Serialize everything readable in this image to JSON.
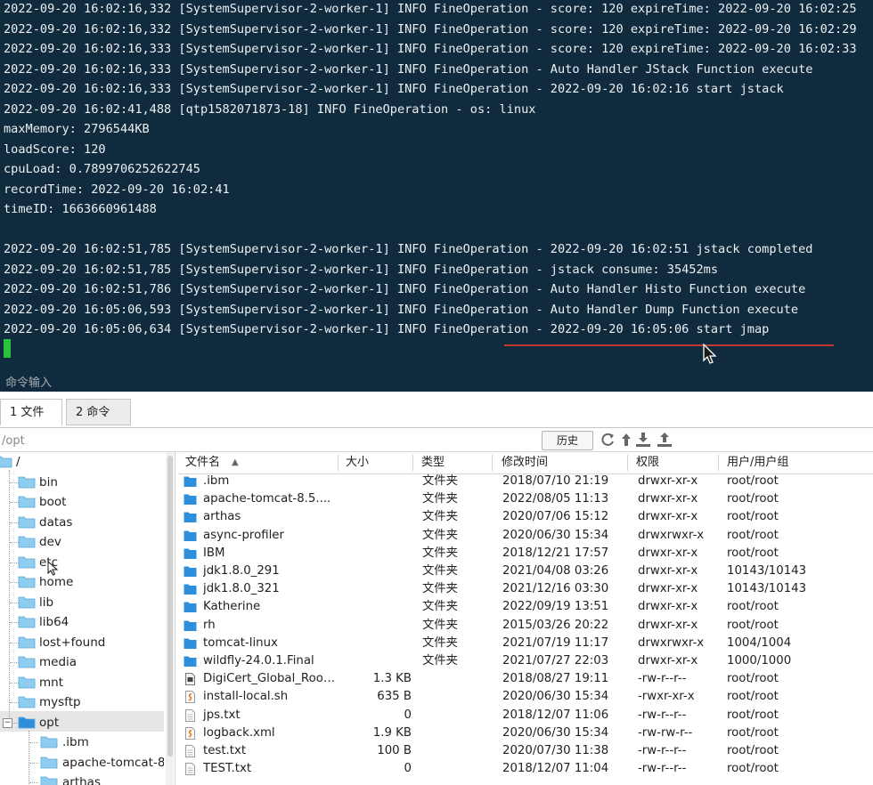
{
  "terminal": {
    "lines": [
      "2022-09-20 16:02:16,332 [SystemSupervisor-2-worker-1] INFO FineOperation - score: 120 expireTime: 2022-09-20 16:02:25",
      "2022-09-20 16:02:16,332 [SystemSupervisor-2-worker-1] INFO FineOperation - score: 120 expireTime: 2022-09-20 16:02:29",
      "2022-09-20 16:02:16,333 [SystemSupervisor-2-worker-1] INFO FineOperation - score: 120 expireTime: 2022-09-20 16:02:33",
      "2022-09-20 16:02:16,333 [SystemSupervisor-2-worker-1] INFO FineOperation - Auto Handler JStack Function execute",
      "2022-09-20 16:02:16,333 [SystemSupervisor-2-worker-1] INFO FineOperation - 2022-09-20 16:02:16 start jstack",
      "2022-09-20 16:02:41,488 [qtp1582071873-18] INFO FineOperation - os: linux",
      "maxMemory: 2796544KB",
      "loadScore: 120",
      "cpuLoad: 0.7899706252622745",
      "recordTime: 2022-09-20 16:02:41",
      "timeID: 1663660961488",
      "",
      "2022-09-20 16:02:51,785 [SystemSupervisor-2-worker-1] INFO FineOperation - 2022-09-20 16:02:51 jstack completed",
      "2022-09-20 16:02:51,785 [SystemSupervisor-2-worker-1] INFO FineOperation - jstack consume: 35452ms",
      "2022-09-20 16:02:51,786 [SystemSupervisor-2-worker-1] INFO FineOperation - Auto Handler Histo Function execute",
      "2022-09-20 16:05:06,593 [SystemSupervisor-2-worker-1] INFO FineOperation - Auto Handler Dump Function execute",
      "2022-09-20 16:05:06,634 [SystemSupervisor-2-worker-1] INFO FineOperation - 2022-09-20 16:05:06 start jmap"
    ],
    "command_input_label": "命令输入",
    "colors": {
      "background": "#102b3e",
      "text": "#ecf0f3",
      "cursor": "#27c23a",
      "annotation": "#c03a33"
    }
  },
  "tabs": [
    {
      "label": "1 文件",
      "active": true
    },
    {
      "label": "2 命令",
      "active": false
    }
  ],
  "pathbar": {
    "path": "/opt",
    "history_label": "历史",
    "tools": [
      "refresh-icon",
      "go-up-icon",
      "download-icon",
      "upload-icon"
    ]
  },
  "tree": {
    "root": "/",
    "items": [
      "bin",
      "boot",
      "datas",
      "dev",
      "etc",
      "home",
      "lib",
      "lib64",
      "lost+found",
      "media",
      "mnt",
      "mysftp",
      "opt"
    ],
    "selected": "opt",
    "opt_children": [
      ".ibm",
      "apache-tomcat-8",
      "arthas"
    ]
  },
  "file_list": {
    "columns": [
      "文件名",
      "大小",
      "类型",
      "修改时间",
      "权限",
      "用户/用户组"
    ],
    "sort_indicator": "▲",
    "rows": [
      {
        "name": ".ibm",
        "size": "",
        "type": "文件夹",
        "mtime": "2018/07/10 21:19",
        "perm": "drwxr-xr-x",
        "owner": "root/root",
        "icon": "folder-icon"
      },
      {
        "name": "apache-tomcat-8.5....",
        "size": "",
        "type": "文件夹",
        "mtime": "2022/08/05 11:13",
        "perm": "drwxr-xr-x",
        "owner": "root/root",
        "icon": "folder-icon"
      },
      {
        "name": "arthas",
        "size": "",
        "type": "文件夹",
        "mtime": "2020/07/06 15:12",
        "perm": "drwxr-xr-x",
        "owner": "root/root",
        "icon": "folder-icon"
      },
      {
        "name": "async-profiler",
        "size": "",
        "type": "文件夹",
        "mtime": "2020/06/30 15:34",
        "perm": "drwxrwxr-x",
        "owner": "root/root",
        "icon": "folder-icon"
      },
      {
        "name": "IBM",
        "size": "",
        "type": "文件夹",
        "mtime": "2018/12/21 17:57",
        "perm": "drwxr-xr-x",
        "owner": "root/root",
        "icon": "folder-icon"
      },
      {
        "name": "jdk1.8.0_291",
        "size": "",
        "type": "文件夹",
        "mtime": "2021/04/08 03:26",
        "perm": "drwxr-xr-x",
        "owner": "10143/10143",
        "icon": "folder-icon"
      },
      {
        "name": "jdk1.8.0_321",
        "size": "",
        "type": "文件夹",
        "mtime": "2021/12/16 03:30",
        "perm": "drwxr-xr-x",
        "owner": "10143/10143",
        "icon": "folder-icon"
      },
      {
        "name": "Katherine",
        "size": "",
        "type": "文件夹",
        "mtime": "2022/09/19 13:51",
        "perm": "drwxr-xr-x",
        "owner": "root/root",
        "icon": "folder-icon"
      },
      {
        "name": "rh",
        "size": "",
        "type": "文件夹",
        "mtime": "2015/03/26 20:22",
        "perm": "drwxr-xr-x",
        "owner": "root/root",
        "icon": "folder-icon"
      },
      {
        "name": "tomcat-linux",
        "size": "",
        "type": "文件夹",
        "mtime": "2021/07/19 11:17",
        "perm": "drwxrwxr-x",
        "owner": "1004/1004",
        "icon": "folder-icon"
      },
      {
        "name": "wildfly-24.0.1.Final",
        "size": "",
        "type": "文件夹",
        "mtime": "2021/07/27 22:03",
        "perm": "drwxr-xr-x",
        "owner": "1000/1000",
        "icon": "folder-icon"
      },
      {
        "name": "DigiCert_Global_Root...",
        "size": "1.3 KB",
        "type": "",
        "mtime": "2018/08/27 19:11",
        "perm": "-rw-r--r--",
        "owner": "root/root",
        "icon": "certificate-file-icon"
      },
      {
        "name": "install-local.sh",
        "size": "635 B",
        "type": "",
        "mtime": "2020/06/30 15:34",
        "perm": "-rwxr-xr-x",
        "owner": "root/root",
        "icon": "script-file-icon"
      },
      {
        "name": "jps.txt",
        "size": "0",
        "type": "",
        "mtime": "2018/12/07 11:06",
        "perm": "-rw-r--r--",
        "owner": "root/root",
        "icon": "text-file-icon"
      },
      {
        "name": "logback.xml",
        "size": "1.9 KB",
        "type": "",
        "mtime": "2020/06/30 15:34",
        "perm": "-rw-rw-r--",
        "owner": "root/root",
        "icon": "xml-file-icon"
      },
      {
        "name": "test.txt",
        "size": "100 B",
        "type": "",
        "mtime": "2020/07/30 11:38",
        "perm": "-rw-r--r--",
        "owner": "root/root",
        "icon": "text-file-icon"
      },
      {
        "name": "TEST.txt",
        "size": "0",
        "type": "",
        "mtime": "2018/12/07 11:04",
        "perm": "-rw-r--r--",
        "owner": "root/root",
        "icon": "text-file-icon"
      }
    ]
  },
  "colors": {
    "folder": "#2d8fdc",
    "tree_folder": "#8ecdf0",
    "script_accent": "#e07a1f"
  }
}
